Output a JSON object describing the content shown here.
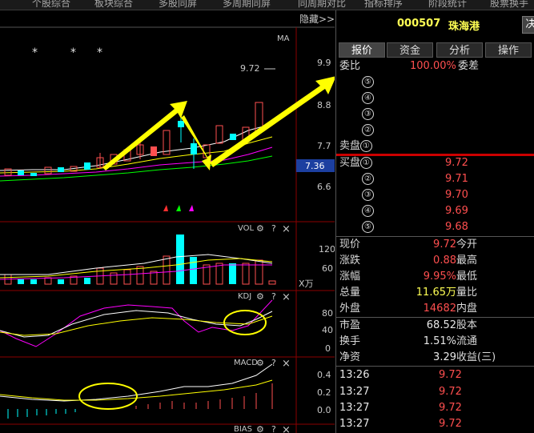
{
  "top_tabs": [
    "个股综合",
    "板块综合",
    "多股同屏",
    "多周期同屏",
    "同周期对比",
    "指标排序",
    "阶段统计",
    "股票换手"
  ],
  "stock": {
    "code": "000507",
    "name": "珠海港",
    "action_label": "决"
  },
  "chart": {
    "hide_label": "隐藏>>",
    "ma_label": "MA",
    "price_label": "9.72",
    "price_ticks": [
      "9.9",
      "8.8",
      "7.7",
      "6.6"
    ],
    "current_price": "7.36",
    "vol_label": "VOL",
    "vol_ticks": [
      "120",
      "60"
    ],
    "vol_unit": "X万",
    "kdj_label": "KDJ",
    "kdj_ticks": [
      "80",
      "40",
      "0"
    ],
    "macd_label": "MACD",
    "macd_ticks": [
      "0.4",
      "0.2",
      "0.0"
    ],
    "bias_label": "BIAS",
    "star_glyph": "*",
    "gear_glyph": "⚙",
    "help_glyph": "?",
    "close_glyph": "×",
    "colors": {
      "up": "#ff5050",
      "down": "#00ffff",
      "ma5": "#ffffff",
      "ma10": "#ffff00",
      "ma20": "#ff00ff",
      "ma60": "#00ff00",
      "annot": "#ffff00"
    }
  },
  "panel": {
    "tabs": [
      "报价",
      "资金",
      "分析",
      "操作"
    ],
    "weibi": {
      "label": "委比",
      "value": "100.00%",
      "label2": "委差"
    },
    "sell_label": "卖盘",
    "buy_label": "买盘",
    "sell_levels": [
      "⑤",
      "④",
      "③",
      "②",
      "①"
    ],
    "buy_levels": [
      {
        "n": "①",
        "price": "9.72"
      },
      {
        "n": "②",
        "price": "9.71"
      },
      {
        "n": "③",
        "price": "9.70"
      },
      {
        "n": "④",
        "price": "9.69"
      },
      {
        "n": "⑤",
        "price": "9.68"
      }
    ],
    "stats": [
      {
        "l1": "现价",
        "v1": "9.72",
        "l2": "今开",
        "c": "red"
      },
      {
        "l1": "涨跌",
        "v1": "0.88",
        "l2": "最高",
        "c": "red"
      },
      {
        "l1": "涨幅",
        "v1": "9.95%",
        "l2": "最低",
        "c": "red"
      },
      {
        "l1": "总量",
        "v1": "11.65万",
        "l2": "量比",
        "c": "yel"
      },
      {
        "l1": "外盘",
        "v1": "14682",
        "l2": "内盘",
        "c": "red"
      }
    ],
    "stats2": [
      {
        "l1": "市盈",
        "v1": "68.52",
        "l2": "股本"
      },
      {
        "l1": "换手",
        "v1": "1.51%",
        "l2": "流通"
      },
      {
        "l1": "净资",
        "v1": "3.29",
        "l2": "收益(三)"
      }
    ],
    "ticks": [
      {
        "time": "13:26",
        "price": "9.72"
      },
      {
        "time": "13:27",
        "price": "9.72"
      },
      {
        "time": "13:27",
        "price": "9.72"
      },
      {
        "time": "13:27",
        "price": "9.72"
      }
    ]
  }
}
